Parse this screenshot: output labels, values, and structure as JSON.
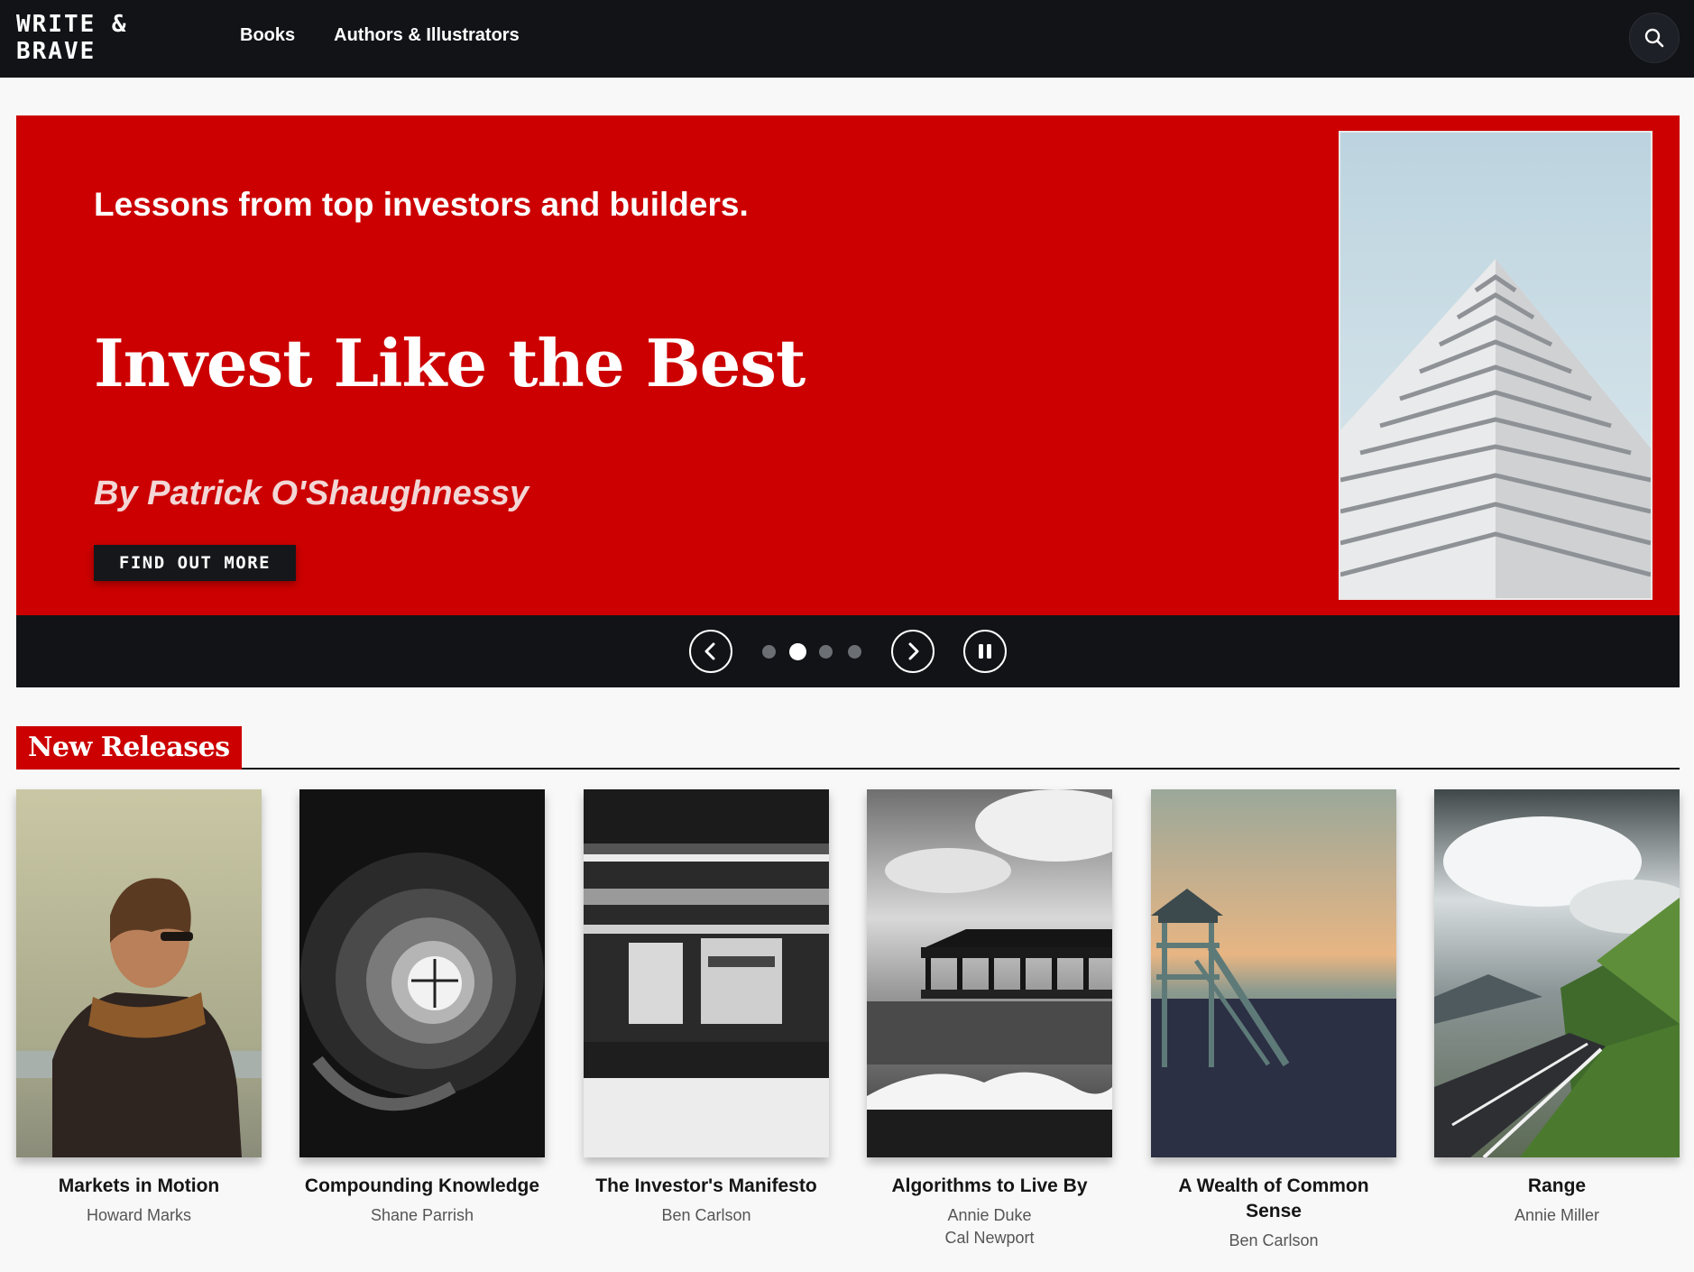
{
  "header": {
    "logo_line1": "WRITE &",
    "logo_line2": "BRAVE",
    "nav": [
      {
        "label": "Books"
      },
      {
        "label": "Authors & Illustrators"
      }
    ],
    "search_icon": "search-icon"
  },
  "hero": {
    "kicker": "Lessons from top investors and builders.",
    "title": "Invest Like the Best",
    "author": "By Patrick O'Shaughnessy",
    "cta": "FIND OUT MORE",
    "accent": "#cc0000"
  },
  "carousel": {
    "prev_icon": "chevron-left-icon",
    "next_icon": "chevron-right-icon",
    "pause_icon": "pause-icon",
    "slides_total": 4,
    "active_slide": 2
  },
  "section": {
    "title": "New Releases"
  },
  "books": [
    {
      "title": "Markets in Motion",
      "authors": [
        "Howard Marks"
      ]
    },
    {
      "title": "Compounding Knowledge",
      "authors": [
        "Shane Parrish"
      ]
    },
    {
      "title": "The Investor's Manifesto",
      "authors": [
        "Ben Carlson"
      ]
    },
    {
      "title": "Algorithms to Live By",
      "authors": [
        "Annie Duke",
        "Cal Newport"
      ]
    },
    {
      "title": "A Wealth of Common Sense",
      "authors": [
        "Ben Carlson"
      ]
    },
    {
      "title": "Range",
      "authors": [
        "Annie Miller"
      ]
    }
  ],
  "colors": {
    "topbar": "#111317",
    "accent": "#cc0000",
    "page": "#f8f8f8"
  }
}
